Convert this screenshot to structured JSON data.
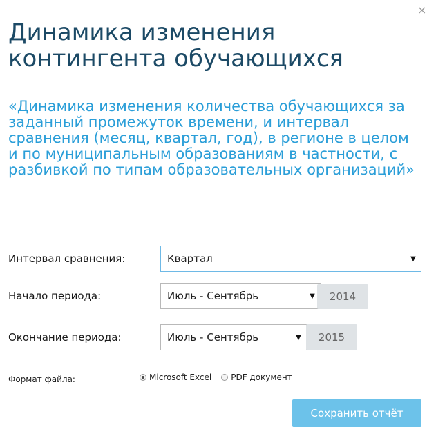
{
  "dialog": {
    "close_glyph": "×",
    "title": "Динамика изменения контингента обучающихся",
    "subtitle": "«Динамика изменения количества обучающихся за заданный промежуток времени, и интервал сравнения (месяц, квартал, год), в регионе в целом и по муниципальным образованиям в частности, с разбивкой по типам образовательных организаций»"
  },
  "form": {
    "interval": {
      "label": "Интервал сравнения:",
      "value": "Квартал"
    },
    "start": {
      "label": "Начало периода:",
      "value": "Июль - Сентябрь",
      "year": "2014"
    },
    "end": {
      "label": "Окончание периода:",
      "value": "Июль - Сентябрь",
      "year": "2015"
    },
    "format": {
      "label": "Формат файла:",
      "options": [
        {
          "label": "Microsoft Excel",
          "selected": true
        },
        {
          "label": "PDF документ",
          "selected": false
        }
      ]
    },
    "save_label": "Сохранить отчёт"
  },
  "icons": {
    "caret": "▼",
    "close": "close-icon"
  },
  "colors": {
    "title": "#1c4a66",
    "subtitle": "#2a9ed8",
    "button": "#6cc2ea",
    "year_bg": "#dfe3e6"
  }
}
